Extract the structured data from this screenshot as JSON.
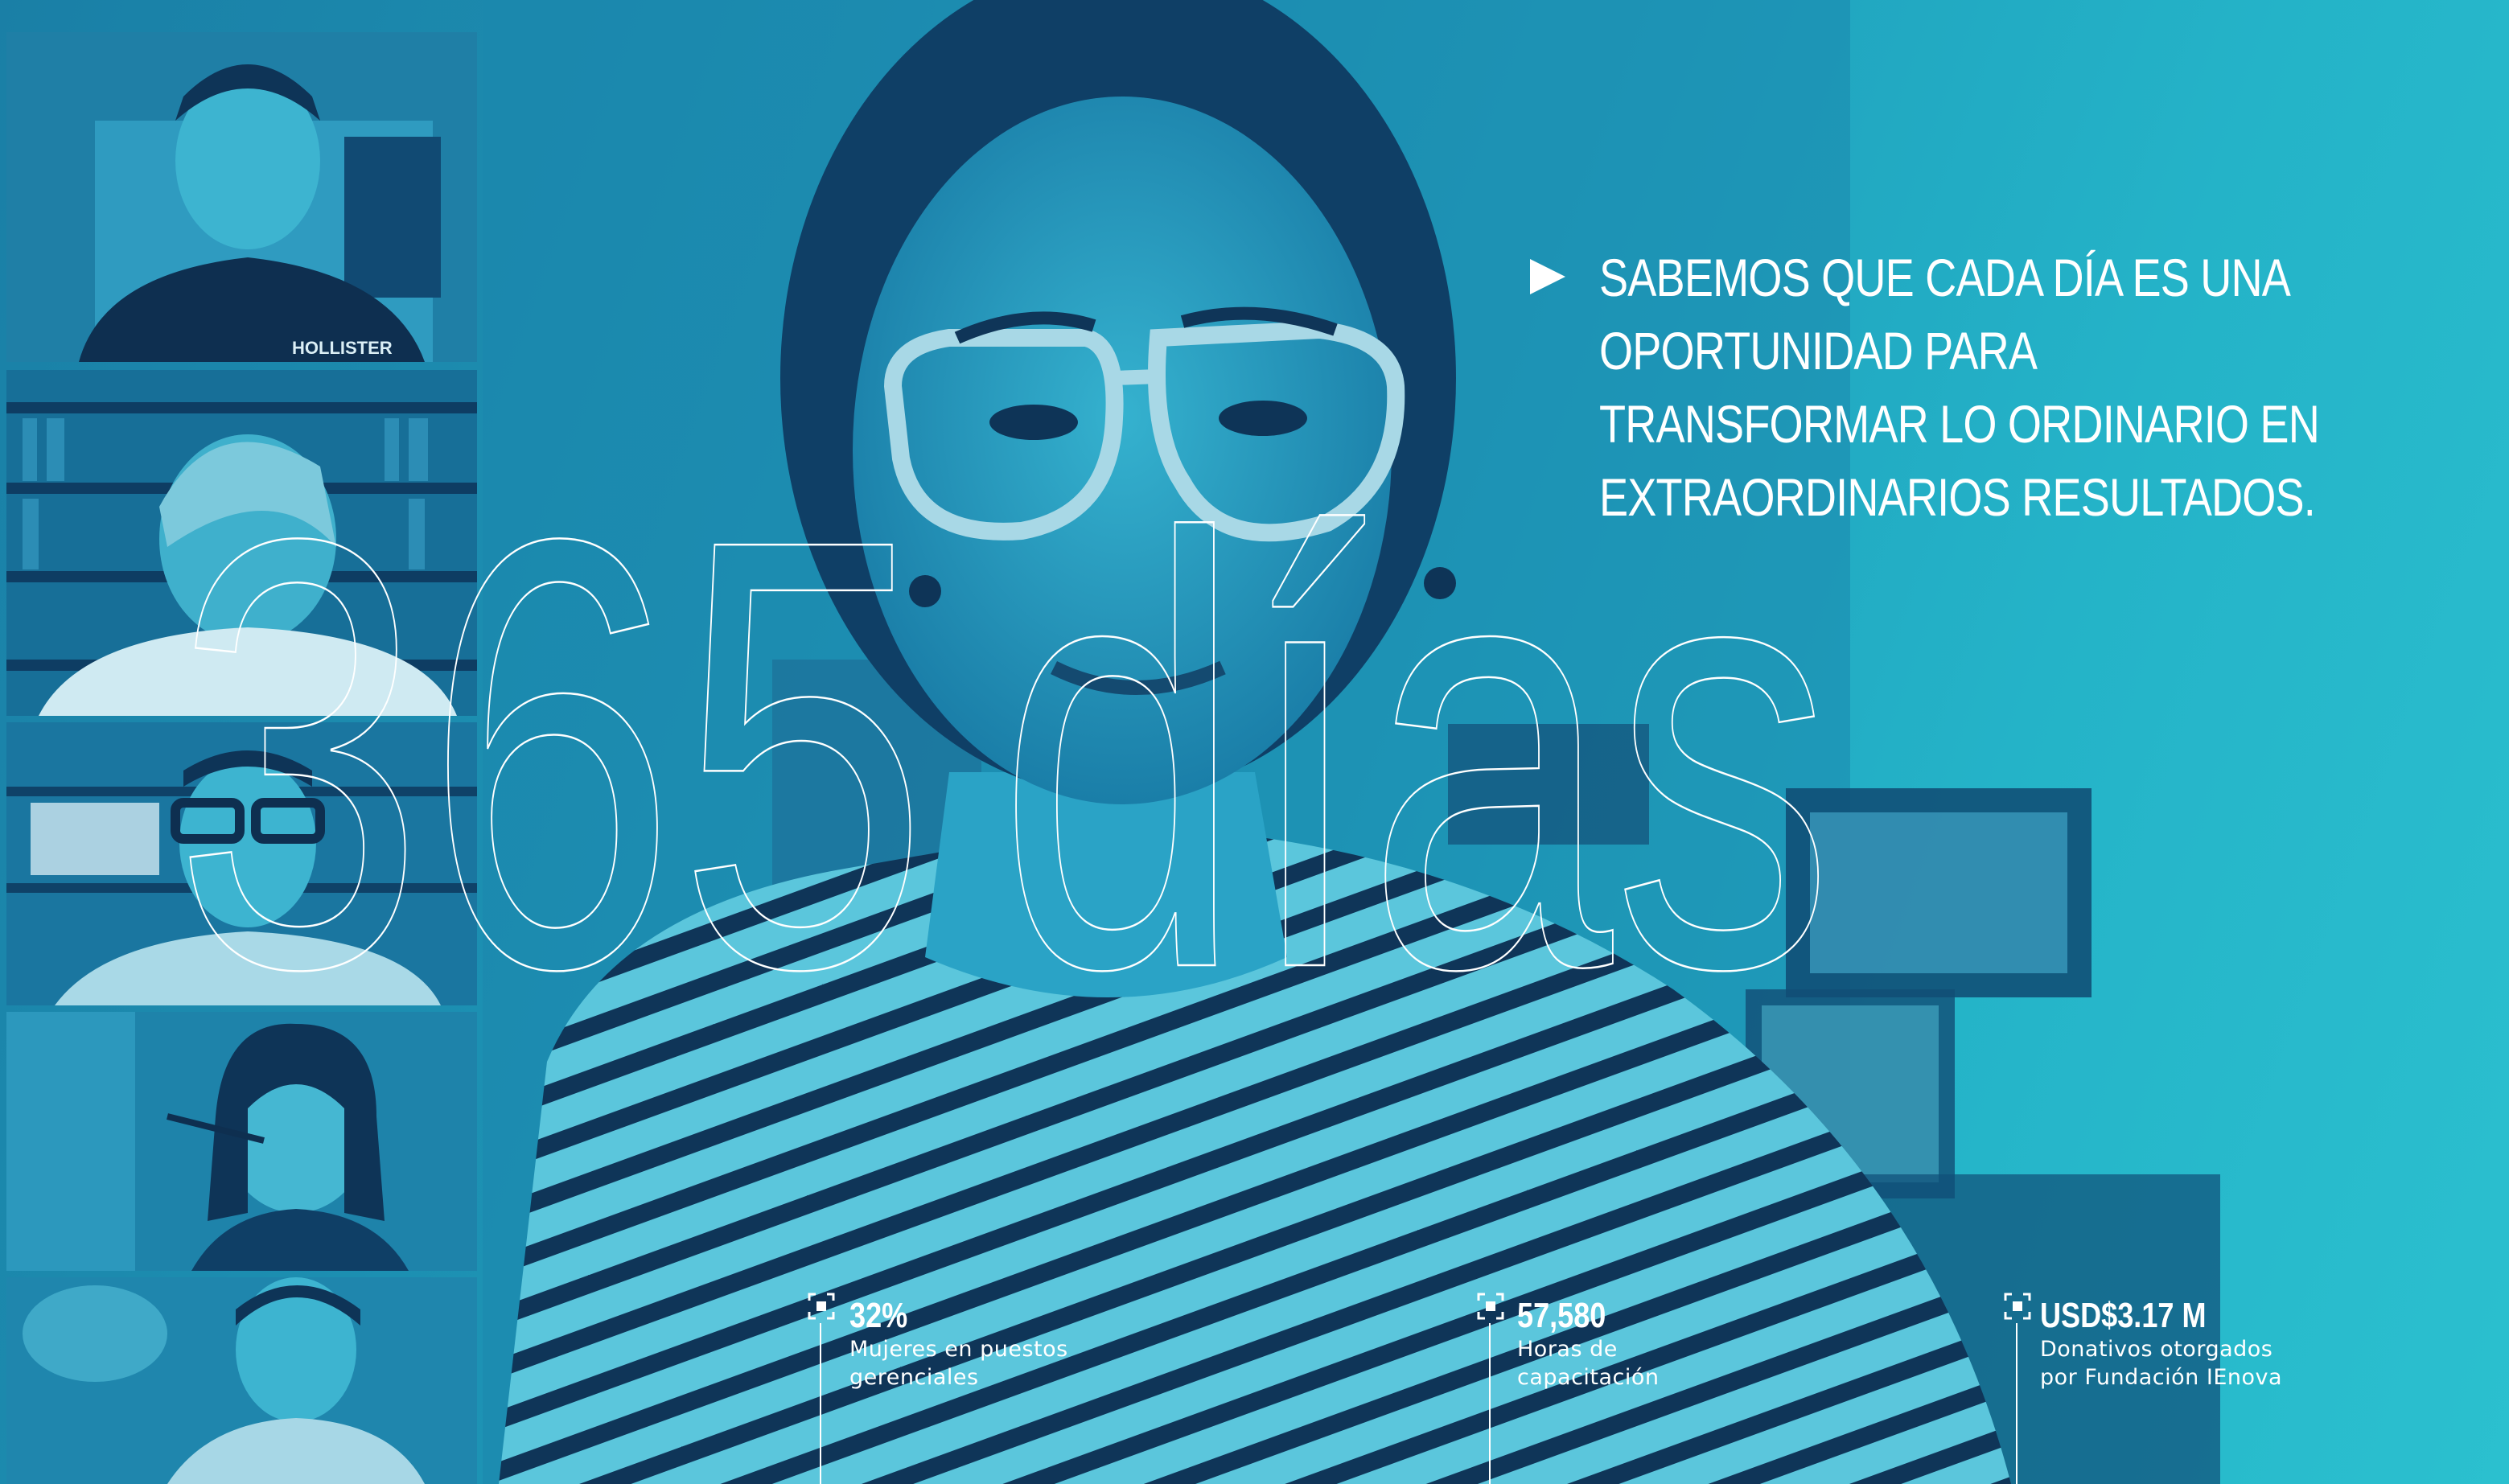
{
  "headline": {
    "lines": [
      "SABEMOS QUE CADA DÍA ES UNA",
      "OPORTUNIDAD PARA",
      "TRANSFORMAR LO ORDINARIO EN",
      "EXTRAORDINARIOS RESULTADOS."
    ]
  },
  "big_number": "365",
  "big_word": "días",
  "tiles": [
    {
      "name": "participant-1",
      "shirt_text": "HOLLISTER"
    },
    {
      "name": "participant-2"
    },
    {
      "name": "participant-3"
    },
    {
      "name": "participant-4"
    },
    {
      "name": "participant-5"
    }
  ],
  "stats": [
    {
      "value": "32%",
      "label_line1": "Mujeres en puestos",
      "label_line2": "gerenciales"
    },
    {
      "value": "57,580",
      "label_line1": "Horas de",
      "label_line2": "capacitación"
    },
    {
      "value": "USD$3.17 M",
      "label_line1": "Donativos otorgados",
      "label_line2": "por Fundación IEnova"
    }
  ],
  "colors": {
    "bg_dark": "#1a7fa6",
    "bg_light": "#2bc0cf",
    "duotone_dark": "#0e3f66",
    "text": "#ffffff"
  }
}
